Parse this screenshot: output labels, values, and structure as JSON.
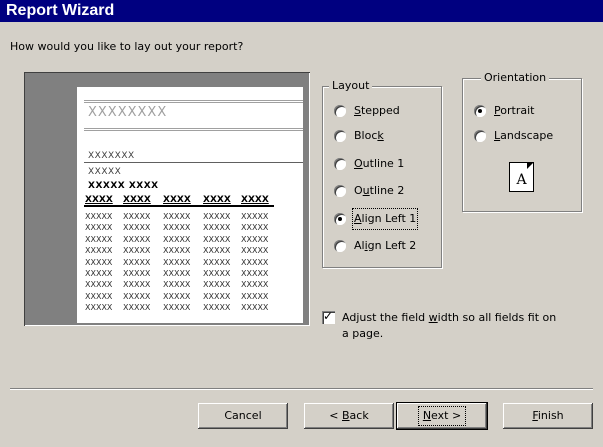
{
  "window": {
    "title": "Report Wizard"
  },
  "prompt": "How would you like to lay out your report?",
  "preview": {
    "title": "XXXXXXXX",
    "group1": "XXXXXXX",
    "group2": "XXXXX",
    "group3": "XXXXX XXXX",
    "headers": [
      "XXXX",
      "XXXX",
      "XXXX",
      "XXXX",
      "XXXX"
    ],
    "cell": "XXXXX",
    "row_count": 9
  },
  "layout": {
    "legend": "Layout",
    "options": [
      {
        "pre": "",
        "key": "S",
        "post": "tepped",
        "selected": false
      },
      {
        "pre": "Bloc",
        "key": "k",
        "post": "",
        "selected": false
      },
      {
        "pre": "",
        "key": "O",
        "post": "utline 1",
        "selected": false
      },
      {
        "pre": "O",
        "key": "u",
        "post": "tline 2",
        "selected": false
      },
      {
        "pre": "",
        "key": "A",
        "post": "lign Left 1",
        "selected": true
      },
      {
        "pre": "Al",
        "key": "i",
        "post": "gn Left 2",
        "selected": false
      }
    ]
  },
  "orientation": {
    "legend": "Orientation",
    "portrait": {
      "pre": "",
      "key": "P",
      "post": "ortrait",
      "selected": true
    },
    "landscape": {
      "pre": "",
      "key": "L",
      "post": "andscape",
      "selected": false
    },
    "icon_letter": "A"
  },
  "adjust": {
    "checked": true,
    "line1_pre": "Adjust the field ",
    "line1_key": "w",
    "line1_post": "idth so all fields fit on",
    "line2": "a page."
  },
  "buttons": {
    "cancel": "Cancel",
    "back": {
      "pre": "< ",
      "key": "B",
      "post": "ack"
    },
    "next": {
      "pre": "",
      "key": "N",
      "post": "ext >"
    },
    "finish": {
      "pre": "",
      "key": "F",
      "post": "inish"
    }
  }
}
